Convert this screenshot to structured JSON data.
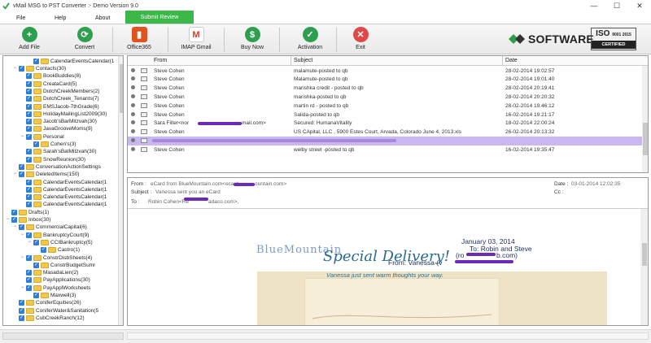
{
  "window": {
    "title": "vMail MSG to PST Converter :- Demo Version 9.0",
    "controls": [
      "—",
      "☐",
      "✕"
    ]
  },
  "menu": {
    "items": [
      "File",
      "Help",
      "About"
    ],
    "submit_review": "Submit Review"
  },
  "toolbar": {
    "buttons": [
      {
        "label": "Add File",
        "icon": "add-icon",
        "color": "#2e9e4f"
      },
      {
        "label": "Convert",
        "icon": "refresh-icon",
        "color": "#2e9e4f"
      },
      {
        "label": "Office365",
        "icon": "office365-icon",
        "color": "#e0531f"
      },
      {
        "label": "IMAP Gmail",
        "icon": "gmail-icon",
        "color": "#d93b2b"
      },
      {
        "label": "Buy Now",
        "icon": "dollar-icon",
        "color": "#2e9e4f"
      },
      {
        "label": "Activation",
        "icon": "check-icon",
        "color": "#2e9e4f"
      },
      {
        "label": "Exit",
        "icon": "close-icon",
        "color": "#e04848"
      }
    ]
  },
  "brand": {
    "logo_text": "SOFTWARE",
    "iso_top": "ISO",
    "iso_num": "9001 2015",
    "iso_bottom": "CERTIFIED"
  },
  "tree": {
    "items": [
      {
        "label": "CalendarEventsCalendar(1",
        "indent": 4
      },
      {
        "label": "Contacts(30)",
        "indent": 2,
        "expander": "−"
      },
      {
        "label": "BookBuddies(8)",
        "indent": 3
      },
      {
        "label": "CreataCard(5)",
        "indent": 3
      },
      {
        "label": "DutchCreekMembers(2)",
        "indent": 3
      },
      {
        "label": "DutchCreek_Tenants(7)",
        "indent": 3
      },
      {
        "label": "EMSJacob-7thGrade(6)",
        "indent": 3
      },
      {
        "label": "HolidayMailingList2009(30)",
        "indent": 3
      },
      {
        "label": "Jacob'sBarMitzvah(30)",
        "indent": 3
      },
      {
        "label": "JavaGrooveMoms(9)",
        "indent": 3
      },
      {
        "label": "Personal",
        "indent": 3,
        "expander": "−"
      },
      {
        "label": "Cohen's(3)",
        "indent": 4
      },
      {
        "label": "Sarah'sBatMitzvah(30)",
        "indent": 3
      },
      {
        "label": "SnowReunion(30)",
        "indent": 3
      },
      {
        "label": "ConversationActionSettings",
        "indent": 2
      },
      {
        "label": "DeletedItems(150)",
        "indent": 2,
        "expander": "−"
      },
      {
        "label": "CalendarEventsCalendar(1",
        "indent": 3
      },
      {
        "label": "CalendarEventsCalendar(1",
        "indent": 3
      },
      {
        "label": "CalendarEventsCalendar(1",
        "indent": 3
      },
      {
        "label": "CalendarEventsCalendar(1",
        "indent": 3
      },
      {
        "label": "Drafts(1)",
        "indent": 1
      },
      {
        "label": "Inbox(30)",
        "indent": 1,
        "expander": "−"
      },
      {
        "label": "CommercialCapital(6)",
        "indent": 2,
        "expander": "−"
      },
      {
        "label": "BankruptcyCourt(9)",
        "indent": 3,
        "expander": "−"
      },
      {
        "label": "CCIBankruptcy(5)",
        "indent": 4,
        "expander": "−"
      },
      {
        "label": "Castro(1)",
        "indent": 5
      },
      {
        "label": "ConstrDisbSheets(4)",
        "indent": 3,
        "expander": "−"
      },
      {
        "label": "ConstrBudgetSumr",
        "indent": 4
      },
      {
        "label": "MasadaLien(2)",
        "indent": 3
      },
      {
        "label": "PayApplications(30)",
        "indent": 3
      },
      {
        "label": "PayApplWorksheets",
        "indent": 3,
        "expander": "−"
      },
      {
        "label": "Maxwell(3)",
        "indent": 4
      },
      {
        "label": "ConiferEquities(26)",
        "indent": 2
      },
      {
        "label": "ConiferWater&Sanitation(5",
        "indent": 2
      },
      {
        "label": "CubCreekRanch(12)",
        "indent": 2
      }
    ]
  },
  "message_list": {
    "columns": [
      "From",
      "Subject",
      "Date"
    ],
    "rows": [
      {
        "from": "Steve Cohen",
        "subject": "malamute-posted to qb",
        "date": "28-02-2014 19:02:57"
      },
      {
        "from": "Steve Cohen",
        "subject": "Malamute-posted to qb",
        "date": "28-02-2014 19:01:40"
      },
      {
        "from": "Steve Cohen",
        "subject": "marishka credit  - posted to qb",
        "date": "28-02-2014 20:19:41"
      },
      {
        "from": "Steve Cohen",
        "subject": "marishka-posted to qb",
        "date": "28-02-2014 20:20:32"
      },
      {
        "from": "Steve Cohen",
        "subject": "martin rd  - posted to qb",
        "date": "28-02-2014 19:46:12"
      },
      {
        "from": "Steve Cohen",
        "subject": "Salida-posted to qb",
        "date": "16-02-2014 19:21:17"
      },
      {
        "from": "Sara Filter<nor",
        "from_tail": "mail.com>",
        "subject": "Secured: HumanaVitality",
        "date": "18-02-2014 22:00:24"
      },
      {
        "from": "Steve Cohen",
        "subject": "US CApital, LLC , 5900 Estes Court, Arvada, Colorado June 4, 2013.xls",
        "date": "26-02-2014 20:13:32"
      },
      {
        "from": "",
        "subject": "",
        "date": "",
        "selected": true
      },
      {
        "from": "Steve Cohen",
        "subject": "welby street -posted to qb",
        "date": "16-02-2014 19:35:47"
      }
    ]
  },
  "preview": {
    "labels": {
      "from": "From :",
      "subject": "Subject :",
      "to": "To :",
      "date": "Date :",
      "cc": "Cc :"
    },
    "from_value": "eCard from BlueMountain.com<ecard",
    "from_value_tail": "ountain.com>",
    "subject_value": "Vanessa sent you an eCard",
    "to_value": "Robin Cohen<Re",
    "to_value_tail": "adaco.com>,",
    "date_value": "03-01-2014 12:02:35",
    "cc_value": "",
    "body": {
      "brand": "BlueMountain",
      "letter_date": "January 03, 2014",
      "to_line": "To: Robin and Steve",
      "email_line_start": "(ro",
      "email_line_end": "b.com)",
      "from_line": "From: Vanessa  (v",
      "card_title": "Special Delivery!",
      "card_subtitle": "Vanessa just sent warm thoughts your way."
    }
  },
  "colors": {
    "accent_green": "#3cb84a",
    "selection": "#c9b8f0",
    "redaction": "#6b2ab8",
    "checkbox_blue": "#2f7ed8",
    "folder_yellow": "#f2c84b"
  }
}
